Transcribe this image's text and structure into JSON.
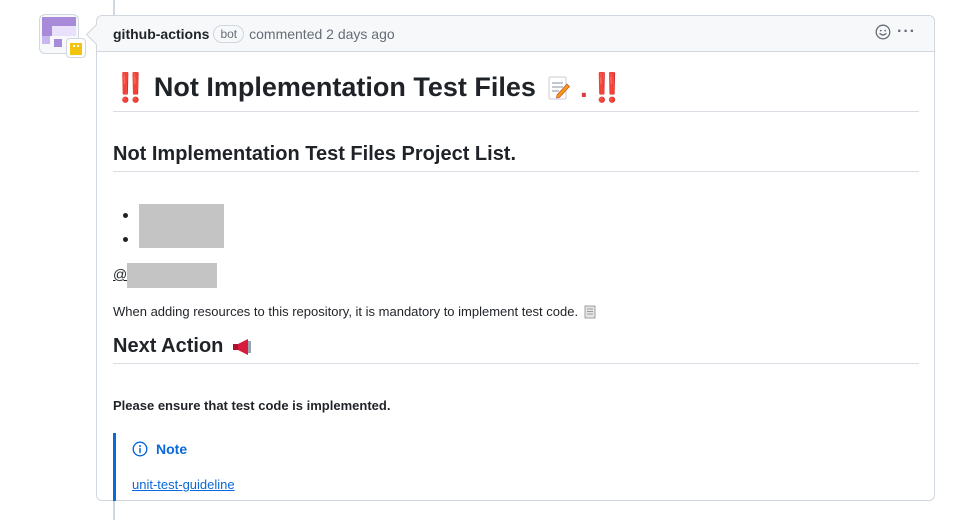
{
  "comment": {
    "author": "github-actions",
    "author_label": "bot",
    "meta": "commented 2 days ago",
    "more_glyph": "···"
  },
  "body": {
    "title_prefix": "‼️",
    "title_text": "Not Implementation Test Files",
    "title_suffix": ". ‼️",
    "section1_heading": "Not Implementation Test Files Project List.",
    "mention_prefix": "@",
    "resource_note": "When adding resources to this repository, it is mandatory to implement test code.",
    "section2_heading": "Next Action",
    "ensure_text": "Please ensure that test code is implemented.",
    "note_title": "Note",
    "note_link": "unit-test-guideline"
  },
  "icons": {
    "memo": "memo-icon",
    "scroll": "scroll-icon",
    "megaphone": "megaphone-icon",
    "info": "info-icon",
    "smile": "smiley-icon",
    "more": "kebab-horizontal-icon"
  },
  "colors": {
    "accent_blue": "#0969da",
    "alert_red": "#e03a3e",
    "border": "#d0d7de",
    "header_bg": "#f6f8fa",
    "redaction": "#c4c4c4"
  }
}
